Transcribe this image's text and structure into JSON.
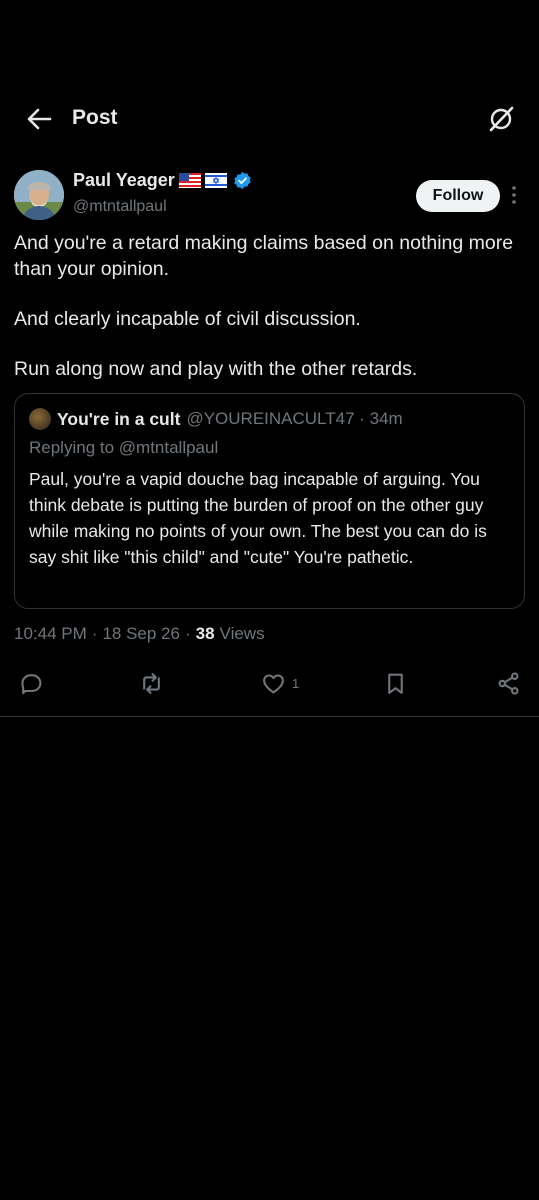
{
  "header": {
    "title": "Post"
  },
  "author": {
    "name": "Paul Yeager",
    "handle": "@mtntallpaul",
    "follow_label": "Follow"
  },
  "tweet": {
    "paragraphs": [
      "And you're a retard making claims based on nothing more than your opinion.",
      "And clearly incapable of civil discussion.",
      "Run along now and play with the other retards."
    ]
  },
  "quote": {
    "name": "You're in a cult",
    "meta": "@YOUREINACULT47 · 34m",
    "replying": "Replying to @mtntallpaul",
    "body": "Paul, you're a vapid douche bag incapable of arguing. You think debate is putting the burden of proof on the other guy while making no points of your own. The best you can do is say shit like \"this child\" and \"cute\" You're pathetic."
  },
  "meta": {
    "time": "10:44 PM",
    "date": "18 Sep 26",
    "views_count": "38",
    "views_label": "Views"
  },
  "actions": {
    "like_count": "1"
  },
  "colors": {
    "background": "#000000",
    "text": "#e7e9ea",
    "muted": "#71767b",
    "verified": "#1d9bf0",
    "border": "#2f3336"
  }
}
